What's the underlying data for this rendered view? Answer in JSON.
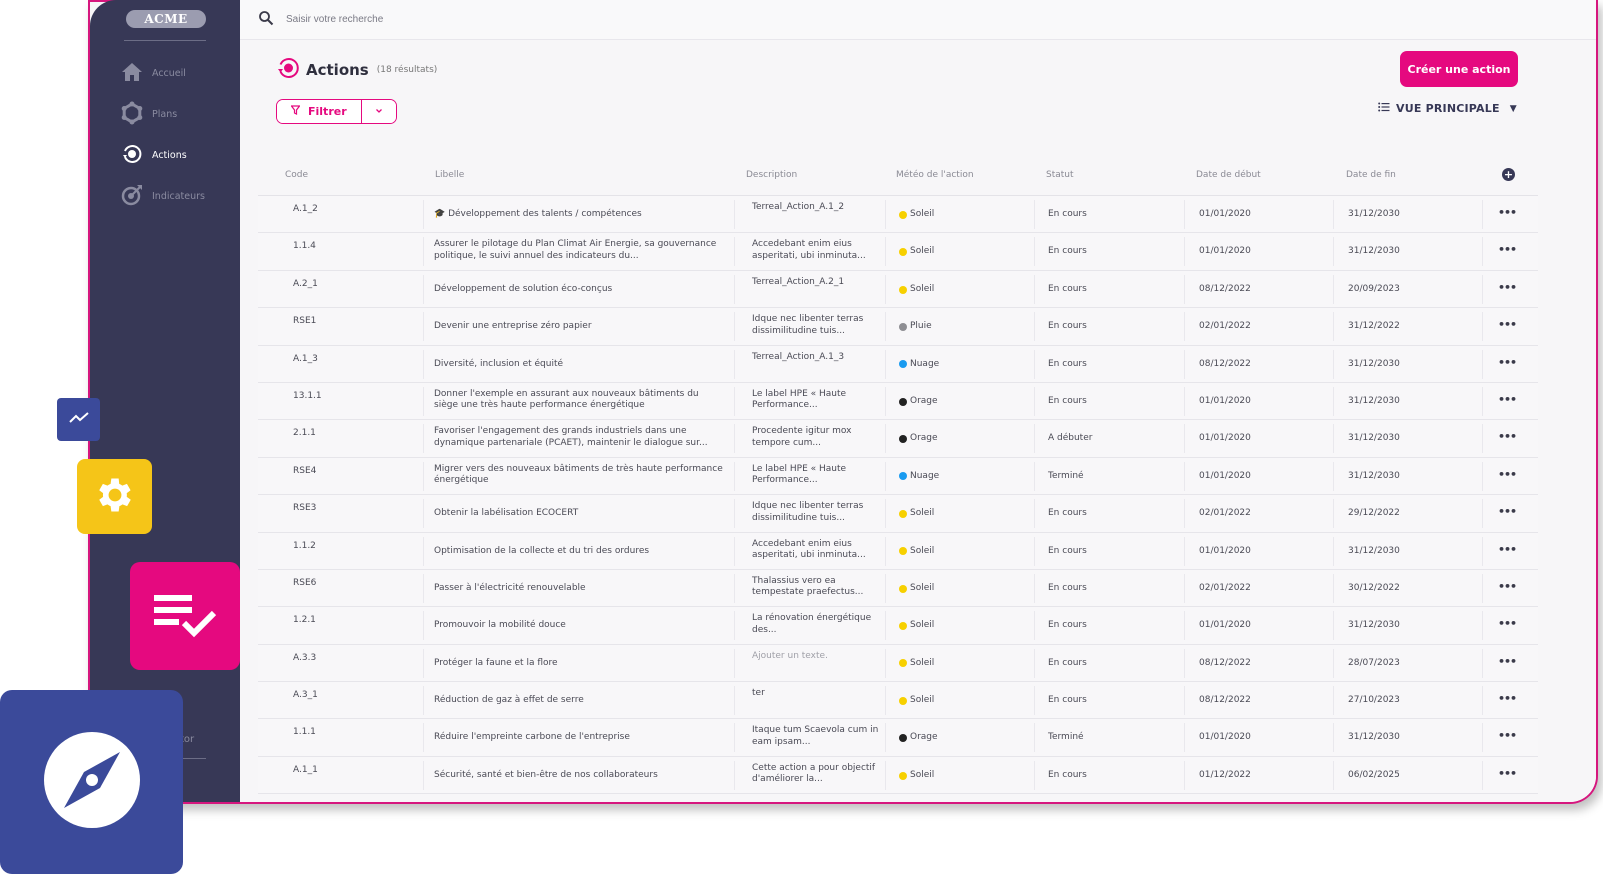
{
  "app": {
    "logo": "ACME",
    "colors": {
      "brand": "#e5097f",
      "sidebar": "#373856",
      "accent_blue": "#3b4a9a",
      "accent_yellow": "#f5c518"
    }
  },
  "sidebar": {
    "items": [
      {
        "label": "Accueil",
        "icon": "home-icon",
        "active": false
      },
      {
        "label": "Plans",
        "icon": "plans-icon",
        "active": false
      },
      {
        "label": "Actions",
        "icon": "actions-icon",
        "active": true
      },
      {
        "label": "Indicateurs",
        "icon": "target-icon",
        "active": false
      }
    ],
    "bottom_text": "tor"
  },
  "search": {
    "placeholder": "Saisir votre recherche"
  },
  "header": {
    "title": "Actions",
    "count": "(18 résultats)",
    "create_button": "Créer une action",
    "filter_label": "Filtrer",
    "view_label": "VUE PRINCIPALE"
  },
  "table": {
    "columns": [
      "Code",
      "Libelle",
      "Description",
      "Météo de l'action",
      "Statut",
      "Date de début",
      "Date de fin"
    ],
    "weather_colors": {
      "Soleil": "#f7d000",
      "Pluie": "#8e8e93",
      "Nuage": "#1a9bf0",
      "Orage": "#222222"
    },
    "rows": [
      {
        "code": "A.1_2",
        "libelle": "🎓 Développement des talents / compétences",
        "description": "Terreal_Action_A.1_2",
        "meteo": "Soleil",
        "statut": "En cours",
        "debut": "01/01/2020",
        "fin": "31/12/2030"
      },
      {
        "code": "1.1.4",
        "libelle": "Assurer le pilotage du Plan Climat Air Energie, sa gouvernance politique, le suivi annuel des indicateurs du...",
        "description": "Accedebant enim eius asperitati, ubi inminuta...",
        "meteo": "Soleil",
        "statut": "En cours",
        "debut": "01/01/2020",
        "fin": "31/12/2030"
      },
      {
        "code": "A.2_1",
        "libelle": "Développement de solution éco-conçus",
        "description": "Terreal_Action_A.2_1",
        "meteo": "Soleil",
        "statut": "En cours",
        "debut": "08/12/2022",
        "fin": "20/09/2023"
      },
      {
        "code": "RSE1",
        "libelle": "Devenir une entreprise zéro papier",
        "description": "Idque nec libenter terras dissimilitudine tuis...",
        "meteo": "Pluie",
        "statut": "En cours",
        "debut": "02/01/2022",
        "fin": "31/12/2022"
      },
      {
        "code": "A.1_3",
        "libelle": "Diversité, inclusion et équité",
        "description": "Terreal_Action_A.1_3",
        "meteo": "Nuage",
        "statut": "En cours",
        "debut": "08/12/2022",
        "fin": "31/12/2030"
      },
      {
        "code": "13.1.1",
        "libelle": "Donner l'exemple en assurant aux nouveaux bâtiments du siège une très haute performance énergétique",
        "description": "Le label HPE « Haute Performance...",
        "meteo": "Orage",
        "statut": "En cours",
        "debut": "01/01/2020",
        "fin": "31/12/2030"
      },
      {
        "code": "2.1.1",
        "libelle": "Favoriser l'engagement des grands industriels dans une dynamique partenariale (PCAET), maintenir le dialogue sur...",
        "description": "Procedente igitur mox tempore cum...",
        "meteo": "Orage",
        "statut": "A débuter",
        "debut": "01/01/2020",
        "fin": "31/12/2030"
      },
      {
        "code": "RSE4",
        "libelle": "Migrer vers des nouveaux bâtiments de très haute performance énergétique",
        "description": "Le label HPE « Haute Performance...",
        "meteo": "Nuage",
        "statut": "Terminé",
        "debut": "01/01/2020",
        "fin": "31/12/2030"
      },
      {
        "code": "RSE3",
        "libelle": "Obtenir la labélisation ECOCERT",
        "description": "Idque nec libenter terras dissimilitudine tuis...",
        "meteo": "Soleil",
        "statut": "En cours",
        "debut": "02/01/2022",
        "fin": "29/12/2022"
      },
      {
        "code": "1.1.2",
        "libelle": "Optimisation de la collecte et du tri des ordures",
        "description": "Accedebant enim eius asperitati, ubi inminuta...",
        "meteo": "Soleil",
        "statut": "En cours",
        "debut": "01/01/2020",
        "fin": "31/12/2030"
      },
      {
        "code": "RSE6",
        "libelle": "Passer à l'électricité renouvelable",
        "description": "Thalassius vero ea tempestate praefectus...",
        "meteo": "Soleil",
        "statut": "En cours",
        "debut": "02/01/2022",
        "fin": "30/12/2022"
      },
      {
        "code": "1.2.1",
        "libelle": "Promouvoir la mobilité douce",
        "description": "La rénovation énergétique des...",
        "meteo": "Soleil",
        "statut": "En cours",
        "debut": "01/01/2020",
        "fin": "31/12/2030"
      },
      {
        "code": "A.3.3",
        "libelle": "Protéger la faune et la flore",
        "description": "Ajouter un texte.",
        "description_placeholder": true,
        "meteo": "Soleil",
        "statut": "En cours",
        "debut": "08/12/2022",
        "fin": "28/07/2023"
      },
      {
        "code": "A.3_1",
        "libelle": "Réduction de gaz à effet de serre",
        "description": "ter",
        "meteo": "Soleil",
        "statut": "En cours",
        "debut": "08/12/2022",
        "fin": "27/10/2023"
      },
      {
        "code": "1.1.1",
        "libelle": "Réduire l'empreinte carbone de l'entreprise",
        "description": "Itaque tum Scaevola cum in eam ipsam...",
        "meteo": "Orage",
        "statut": "Terminé",
        "debut": "01/01/2020",
        "fin": "31/12/2030"
      },
      {
        "code": "A.1_1",
        "libelle": "Sécurité, santé et bien-être de nos collaborateurs",
        "description": "Cette action a pour objectif d'améliorer la...",
        "meteo": "Soleil",
        "statut": "En cours",
        "debut": "01/12/2022",
        "fin": "06/02/2025"
      }
    ]
  },
  "floating_tiles": [
    {
      "name": "chart-tile",
      "icon": "trend-line-icon"
    },
    {
      "name": "settings-tile",
      "icon": "gear-icon"
    },
    {
      "name": "tasks-tile",
      "icon": "checklist-icon"
    },
    {
      "name": "compass-tile",
      "icon": "compass-icon"
    }
  ]
}
